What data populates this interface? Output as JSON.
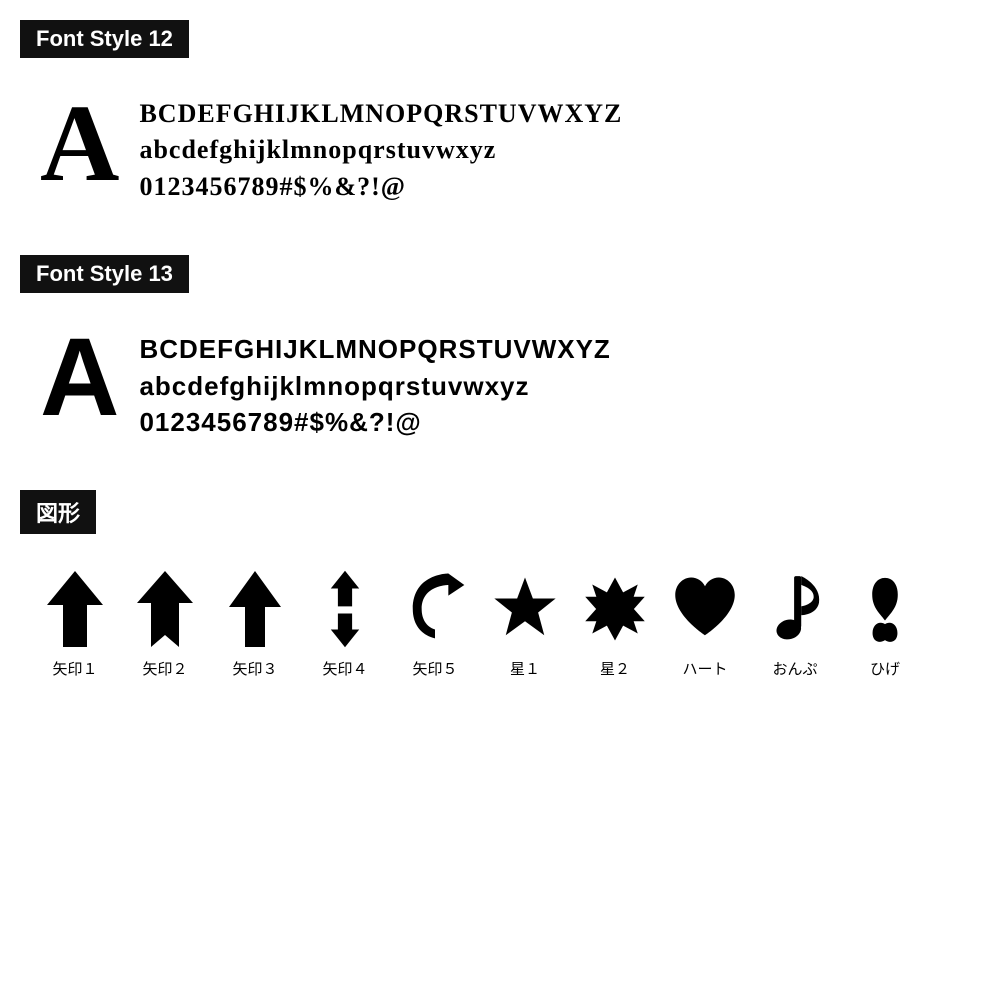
{
  "sections": [
    {
      "id": "font12",
      "header": "Font Style 12",
      "style": "style12",
      "bigLetter": "A",
      "lines": [
        "BCDEFGHIJKLMNOPQRSTUVWXYZ",
        "abcdefghijklmnopqrstuvwxyz",
        "0123456789#$%&?!@"
      ]
    },
    {
      "id": "font13",
      "header": "Font Style 13",
      "style": "style13",
      "bigLetter": "A",
      "lines": [
        "BCDEFGHIJKLMNOPQRSTUVWXYZ",
        "abcdefghijklmnopqrstuvwxyz",
        "0123456789#$%&?!@"
      ]
    }
  ],
  "shapesHeader": "図形",
  "shapes": [
    {
      "id": "yajirushi1",
      "label": "矢印１"
    },
    {
      "id": "yajirushi2",
      "label": "矢印２"
    },
    {
      "id": "yajirushi3",
      "label": "矢印３"
    },
    {
      "id": "yajirushi4",
      "label": "矢印４"
    },
    {
      "id": "yajirushi5",
      "label": "矢印５"
    },
    {
      "id": "hoshi1",
      "label": "星１"
    },
    {
      "id": "hoshi2",
      "label": "星２"
    },
    {
      "id": "heart",
      "label": "ハート"
    },
    {
      "id": "onpu",
      "label": "おんぷ"
    },
    {
      "id": "hige",
      "label": "ひげ"
    }
  ]
}
